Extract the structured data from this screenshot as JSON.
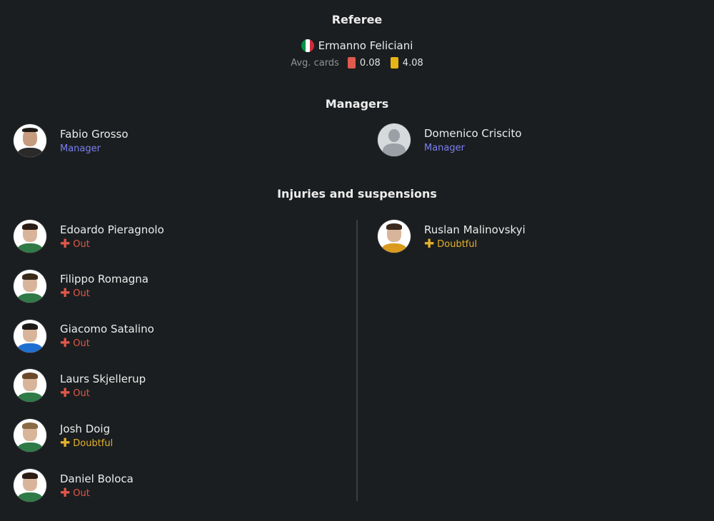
{
  "referee": {
    "title": "Referee",
    "name": "Ermanno Feliciani",
    "avg_label": "Avg. cards",
    "red_avg": "0.08",
    "yellow_avg": "4.08",
    "flag_colors": [
      "#009246",
      "#ffffff",
      "#ce2b37"
    ]
  },
  "managers": {
    "title": "Managers",
    "home": {
      "name": "Fabio Grosso",
      "role": "Manager"
    },
    "away": {
      "name": "Domenico Criscito",
      "role": "Manager"
    }
  },
  "injuries": {
    "title": "Injuries and suspensions",
    "home": [
      {
        "name": "Edoardo Pieragnolo",
        "status": "Out",
        "kit": "#2f7a46",
        "hair": "#2b1d14"
      },
      {
        "name": "Filippo Romagna",
        "status": "Out",
        "kit": "#2f7a46",
        "hair": "#3a2a1c"
      },
      {
        "name": "Giacomo Satalino",
        "status": "Out",
        "kit": "#1f6fd1",
        "hair": "#1e1a18"
      },
      {
        "name": "Laurs Skjellerup",
        "status": "Out",
        "kit": "#2f7a46",
        "hair": "#6b4a2a"
      },
      {
        "name": "Josh Doig",
        "status": "Doubtful",
        "kit": "#2f7a46",
        "hair": "#8a6a45"
      },
      {
        "name": "Daniel Boloca",
        "status": "Out",
        "kit": "#2f7a46",
        "hair": "#2b1d14"
      }
    ],
    "away": [
      {
        "name": "Ruslan Malinovskyi",
        "status": "Doubtful",
        "kit": "#d99a1e",
        "hair": "#3b2a20"
      }
    ]
  },
  "colors": {
    "manager_role": "#7b7ff0",
    "out": "#e0574a",
    "doubtful": "#e3b12c",
    "red_card": "#e05a4e",
    "yellow_card": "#e6b414"
  },
  "icons": {
    "status_out": "red-plus-icon",
    "status_doubtful": "yellow-plus-icon",
    "referee_flag": "italy-flag-icon"
  }
}
